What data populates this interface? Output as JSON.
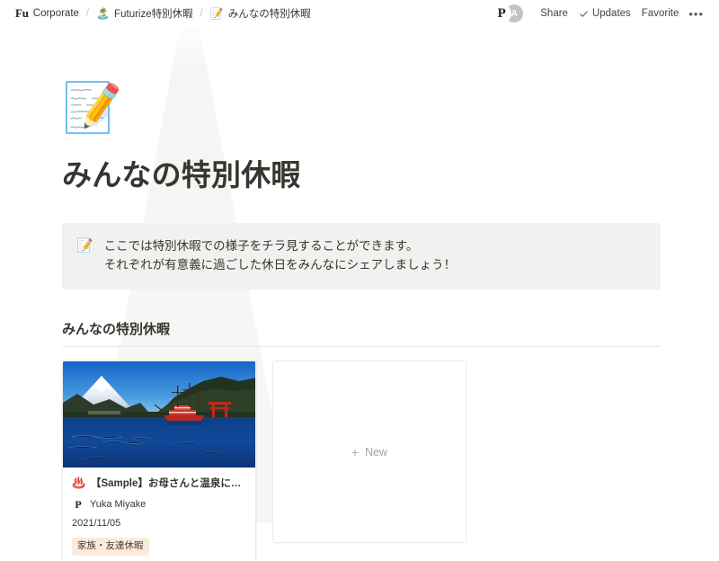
{
  "breadcrumb": {
    "workspace_logo": "Fu",
    "items": [
      {
        "label": "Corporate",
        "icon": ""
      },
      {
        "label": "Futurize特別休暇",
        "icon": "🏝️"
      },
      {
        "label": "みんなの特別休暇",
        "icon": "📝"
      }
    ],
    "separator": "/"
  },
  "topbar": {
    "avatars": [
      {
        "initial": "P",
        "name": "avatar-p"
      },
      {
        "initial": "A",
        "name": "avatar-a"
      }
    ],
    "share_label": "Share",
    "updates_label": "Updates",
    "favorite_label": "Favorite",
    "more_label": "•••"
  },
  "page": {
    "icon": "📝",
    "title": "みんなの特別休暇"
  },
  "callout": {
    "icon": "📝",
    "line1": "ここでは特別休暇での様子をチラ見することができます。",
    "line2": "それぞれが有意義に過ごした休日をみんなにシェアしましょう！",
    "background": "#f1f1ef"
  },
  "section": {
    "heading": "みんなの特別休暇"
  },
  "gallery": {
    "cards": [
      {
        "emoji": "♨️",
        "title": "【Sample】お母さんと温泉に行って…",
        "author": "Yuka Miyake",
        "author_initial": "P",
        "date": "2021/11/05",
        "tag": "家族・友達休暇",
        "tag_color": "#faebdd",
        "image_alt": "lake-ashi-mount-fuji-pirate-ship-photo"
      }
    ],
    "new_card": {
      "plus": "+",
      "label": "New"
    }
  }
}
